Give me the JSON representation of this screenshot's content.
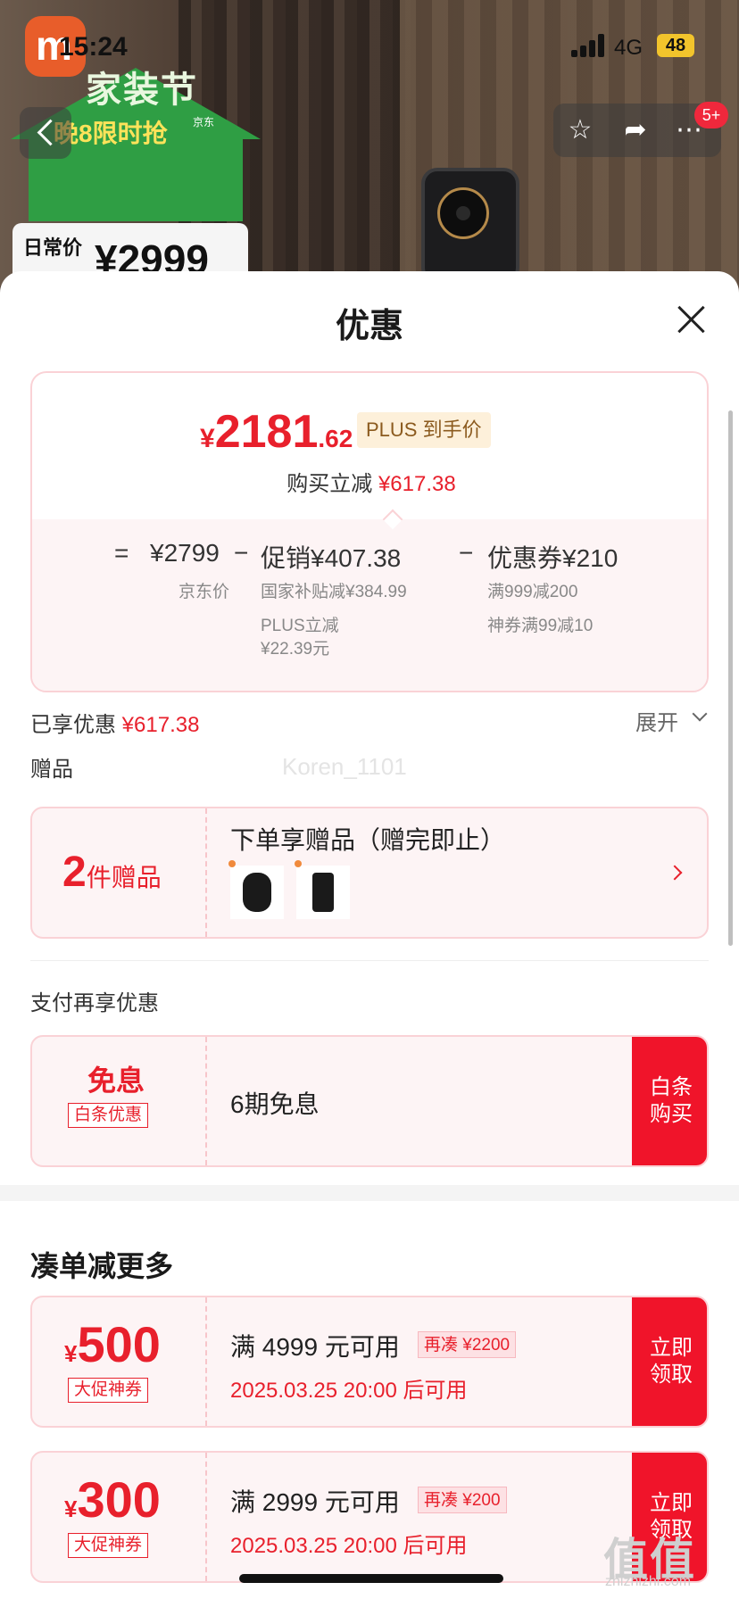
{
  "status": {
    "time": "15:24",
    "network": "4G",
    "battery": "48"
  },
  "hero": {
    "promo_title": "家装节",
    "promo_sub": "晚8限时抢",
    "jd_tag": "京东",
    "price_label": "日常价",
    "price_value": "¥2999",
    "badge_count": "5+",
    "actions": [
      "star-icon",
      "share-icon",
      "more-icon"
    ]
  },
  "sheet": {
    "title": "优惠",
    "final_price": {
      "symbol": "¥",
      "integer": "2181",
      "decimal": ".62"
    },
    "plus_tag": "PLUS 到手价",
    "reduce_label": "购买立减",
    "reduce_value": "¥617.38",
    "breakdown": {
      "eq": "=",
      "jd_price": "¥2799",
      "jd_price_label": "京东价",
      "minus1": "−",
      "promo": "促销¥407.38",
      "promo_detail1": "国家补贴减¥384.99",
      "promo_detail2a": "PLUS立减",
      "promo_detail2b": "¥22.39元",
      "minus2": "−",
      "coupon": "优惠券¥210",
      "coupon_detail1": "满999减200",
      "coupon_detail2": "神券满99减10"
    },
    "enjoyed_label": "已享优惠",
    "enjoyed_value": "¥617.38",
    "expand_label": "展开",
    "watermark": "Koren_1101"
  },
  "gifts": {
    "section_label": "赠品",
    "count": "2",
    "count_unit": "件赠品",
    "title": "下单享赠品（赠完即止）"
  },
  "payment": {
    "section_label": "支付再享优惠",
    "badge": "免息",
    "tag": "白条优惠",
    "plan": "6期免息",
    "button": "白条\n购买"
  },
  "bundle": {
    "section_label": "凑单减更多",
    "coupons": [
      {
        "symbol": "¥",
        "amount": "500",
        "tag": "大促神券",
        "condition": "满 4999 元可用",
        "extra": "再凑 ¥2200",
        "time": "2025.03.25 20:00 后可用",
        "button": "立即\n领取"
      },
      {
        "symbol": "¥",
        "amount": "300",
        "tag": "大促神券",
        "condition": "满 2999 元可用",
        "extra": "再凑 ¥200",
        "time": "2025.03.25 20:00 后可用",
        "button": "立即\n领取"
      }
    ]
  },
  "footer": {
    "site_mark": "值值值",
    "site_url": "zhizhizhi.com"
  }
}
